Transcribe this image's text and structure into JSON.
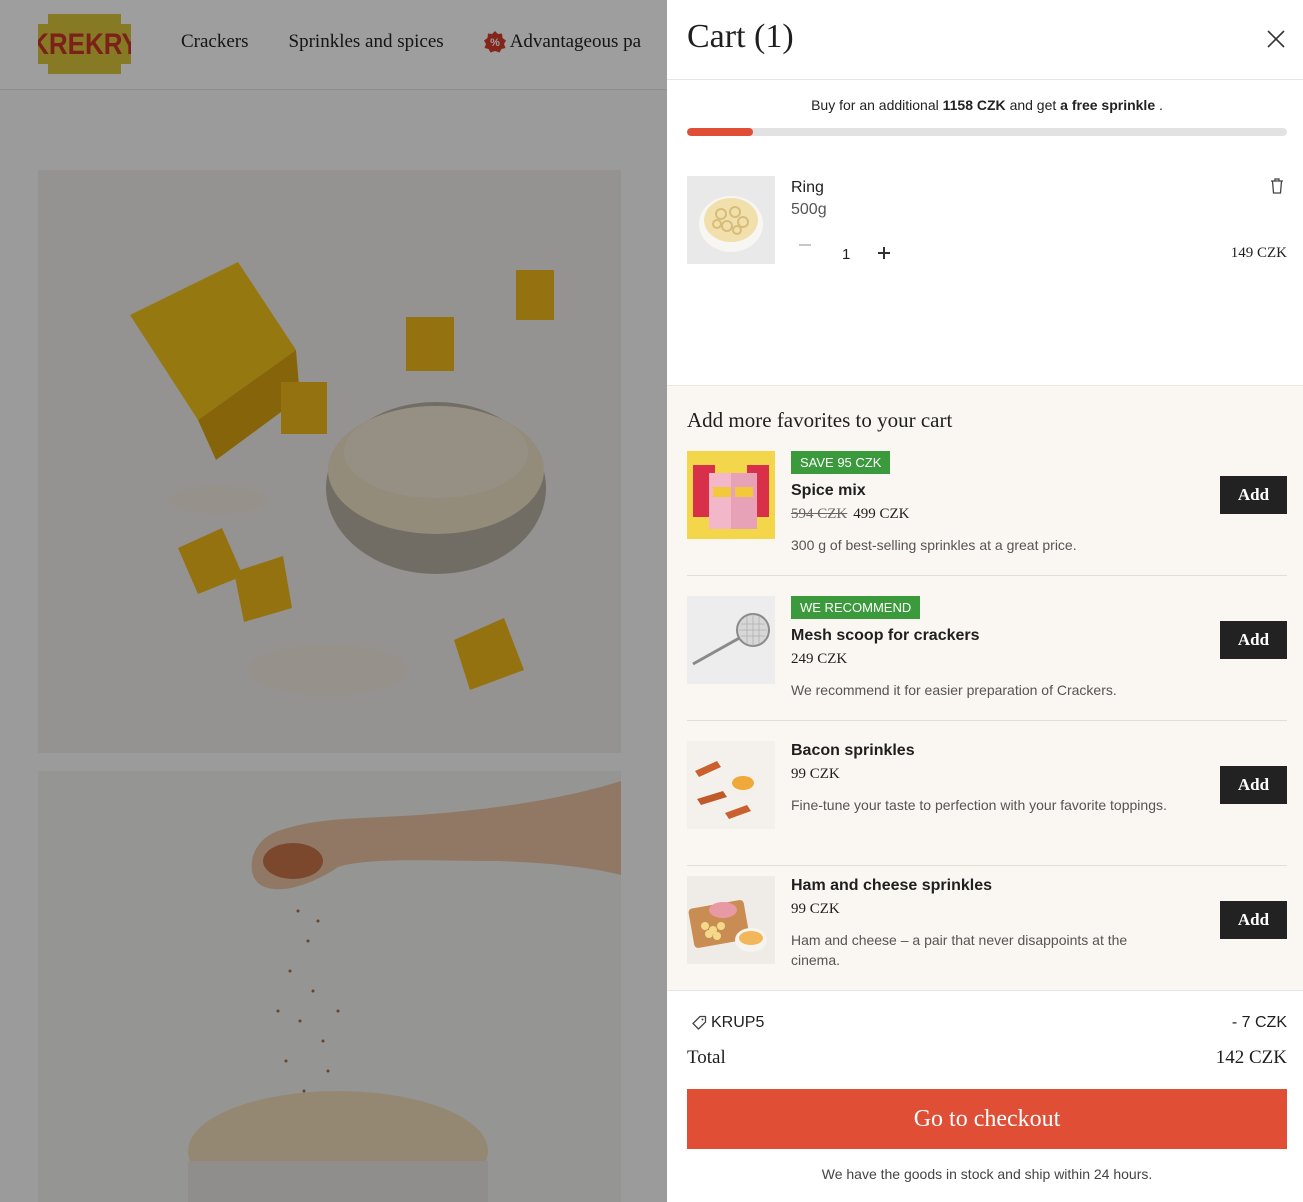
{
  "header": {
    "logo_text": "KREKRY",
    "nav": [
      {
        "label": "Crackers"
      },
      {
        "label": "Sprinkles and spices"
      },
      {
        "label": "Advantageous pa"
      }
    ]
  },
  "cart": {
    "title": "Cart (1)",
    "progress": {
      "prefix": "Buy for an additional",
      "amount": "1158 CZK",
      "middle": "and get",
      "reward": "a free sprinkle",
      "suffix": ".",
      "fraction": 0.11
    },
    "item": {
      "name": "Ring",
      "weight": "500g",
      "quantity": "1",
      "price": "149 CZK"
    },
    "upsell": {
      "title": "Add more favorites to your cart",
      "add_label": "Add",
      "items": [
        {
          "badge": "SAVE 95 CZK",
          "name": "Spice mix",
          "old_price": "594 CZK",
          "price": "499 CZK",
          "desc": "300 g of best-selling sprinkles at a great price."
        },
        {
          "badge": "WE RECOMMEND",
          "name": "Mesh scoop for crackers",
          "price": "249 CZK",
          "desc": "We recommend it for easier preparation of Crackers."
        },
        {
          "name": "Bacon sprinkles",
          "price": "99 CZK",
          "desc": "Fine-tune your taste to perfection with your favorite toppings."
        },
        {
          "name": "Ham and cheese sprinkles",
          "price": "99 CZK",
          "desc": "Ham and cheese – a pair that never disappoints at the cinema."
        }
      ]
    },
    "summary": {
      "coupon_code": "KRUP5",
      "discount": "- 7 CZK",
      "total_label": "Total",
      "total_value": "142 CZK",
      "checkout_label": "Go to checkout",
      "stock_note": "We have the goods in stock and ship within 24 hours."
    }
  },
  "colors": {
    "accent": "#e04e36",
    "badge_green": "#3a9a3c",
    "logo_yellow": "#d9c63a",
    "logo_red": "#c8352a"
  },
  "icons": [
    "close-icon",
    "trash-icon",
    "minus-icon",
    "plus-icon",
    "tag-icon",
    "percent-badge-icon"
  ]
}
